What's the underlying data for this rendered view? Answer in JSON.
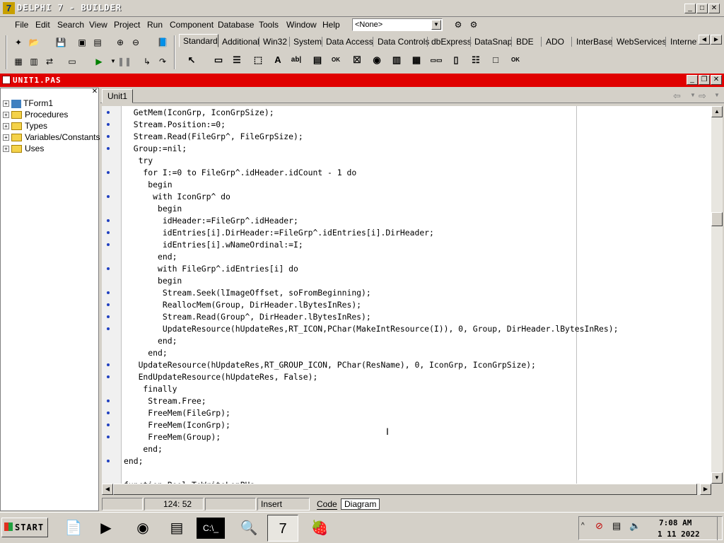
{
  "app": {
    "title": "DELPHI 7 - BUILDER"
  },
  "menu": [
    "File",
    "Edit",
    "Search",
    "View",
    "Project",
    "Run",
    "Component",
    "Database",
    "Tools",
    "Window",
    "Help"
  ],
  "combo": {
    "value": "<None>"
  },
  "palette": {
    "tabs": [
      "Standard",
      "Additional",
      "Win32",
      "System",
      "Data Access",
      "Data Controls",
      "dbExpress",
      "DataSnap",
      "BDE",
      "ADO",
      "InterBase",
      "WebServices",
      "InternetE"
    ]
  },
  "editor": {
    "title": "UNIT1.PAS",
    "tab": "Unit1",
    "explorer": [
      "TForm1",
      "Procedures",
      "Types",
      "Variables/Constants",
      "Uses"
    ],
    "code_lines": [
      "  GetMem(IconGrp, IconGrpSize);",
      "  Stream.Position:=0;",
      "  Stream.Read(FileGrp^, FileGrpSize);",
      "  Group:=nil;",
      "   try",
      "    for I:=0 to FileGrp^.idHeader.idCount - 1 do",
      "     begin",
      "      with IconGrp^ do",
      "       begin",
      "        idHeader:=FileGrp^.idHeader;",
      "        idEntries[i].DirHeader:=FileGrp^.idEntries[i].DirHeader;",
      "        idEntries[i].wNameOrdinal:=I;",
      "       end;",
      "       with FileGrp^.idEntries[i] do",
      "       begin",
      "        Stream.Seek(lImageOffset, soFromBeginning);",
      "        ReallocMem(Group, DirHeader.lBytesInRes);",
      "        Stream.Read(Group^, DirHeader.lBytesInRes);",
      "        UpdateResource(hUpdateRes,RT_ICON,PChar(MakeIntResource(I)), 0, Group, DirHeader.lBytesInRes);",
      "       end;",
      "     end;",
      "   UpdateResource(hUpdateRes,RT_GROUP_ICON, PChar(ResName), 0, IconGrp, IconGrpSize);",
      "   EndUpdateResource(hUpdateRes, False);",
      "    finally",
      "     Stream.Free;",
      "     FreeMem(FileGrp);",
      "     FreeMem(IconGrp);",
      "     FreeMem(Group);",
      "    end;",
      "end;",
      "",
      "function Bool ToWriteLenPUs "
    ],
    "dot_lines": [
      0,
      1,
      2,
      3,
      5,
      7,
      9,
      10,
      11,
      13,
      15,
      16,
      17,
      18,
      21,
      22,
      24,
      25,
      26,
      27,
      29
    ]
  },
  "status": {
    "position": "124: 52",
    "mode": "Insert",
    "tab_code": "Code",
    "tab_diagram": "Diagram"
  },
  "taskbar": {
    "start": "START",
    "time": "7:08 AM",
    "date": "1 11 2022"
  }
}
